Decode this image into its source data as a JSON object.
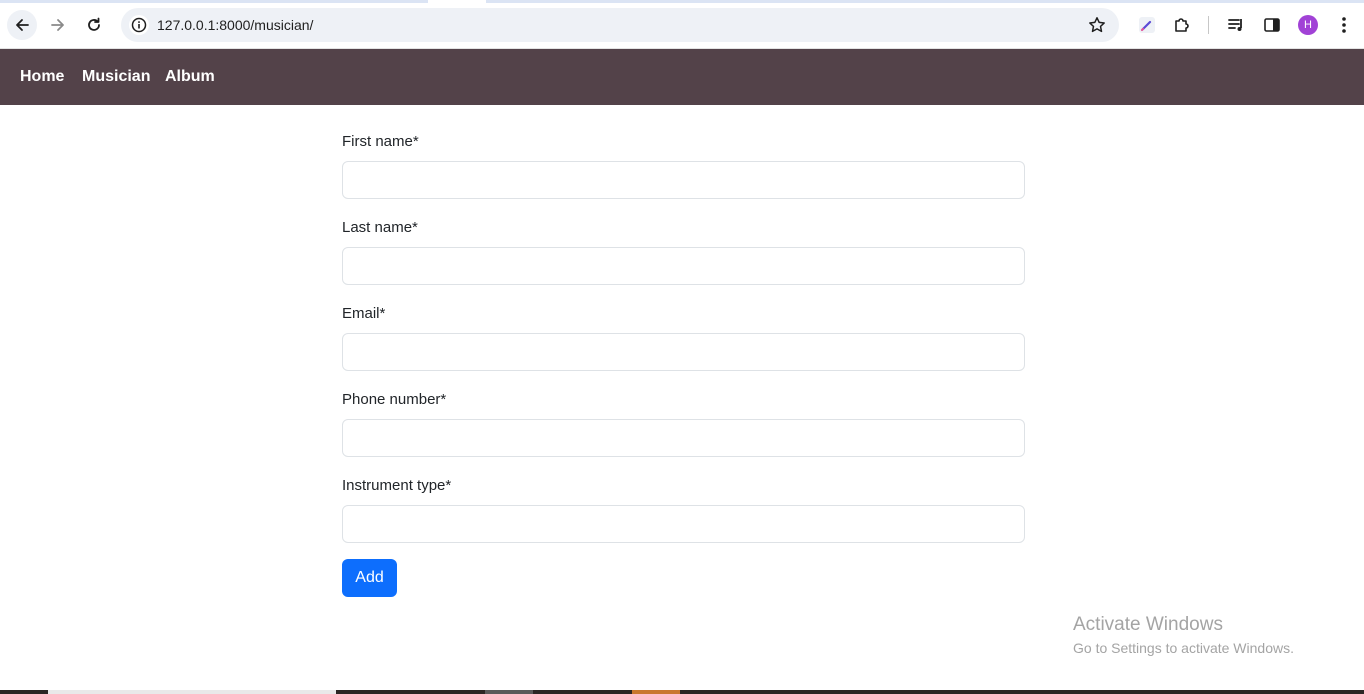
{
  "browser": {
    "url": "127.0.0.1:8000/musician/",
    "profile_initial": "H",
    "icons": [
      "back-arrow-icon",
      "forward-arrow-icon",
      "reload-icon",
      "site-info-icon",
      "bookmark-star-icon",
      "extension-pen-icon",
      "extensions-puzzle-icon",
      "media-controls-icon",
      "side-panel-icon",
      "more-menu-icon"
    ]
  },
  "site_nav": {
    "home": "Home",
    "musician": "Musician",
    "album": "Album",
    "background_color": "#534249"
  },
  "form": {
    "fields": [
      {
        "label": "First name*",
        "value": ""
      },
      {
        "label": "Last name*",
        "value": ""
      },
      {
        "label": "Email*",
        "value": ""
      },
      {
        "label": "Phone number*",
        "value": ""
      },
      {
        "label": "Instrument type*",
        "value": ""
      }
    ],
    "submit_label": "Add",
    "submit_color": "#0d6efd"
  },
  "watermark": {
    "title": "Activate Windows",
    "subtitle": "Go to Settings to activate Windows."
  }
}
